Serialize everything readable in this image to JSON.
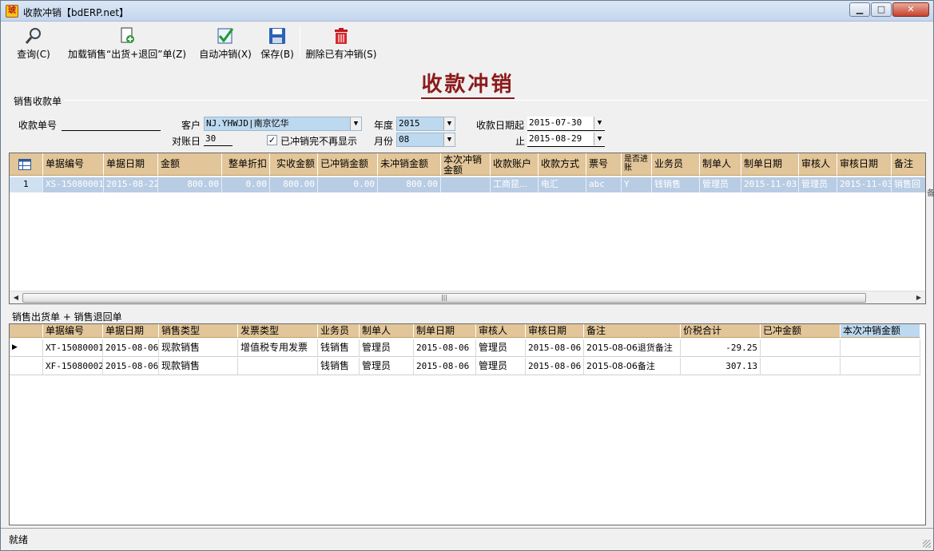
{
  "window": {
    "title": "收款冲销【bdERP.net】",
    "min": "▁",
    "max": "□",
    "close": "✕"
  },
  "toolbar": {
    "query": "查询(C)",
    "load": "加载销售“出货+退回”单(Z)",
    "auto": "自动冲销(X)",
    "save": "保存(B)",
    "delete": "删除已有冲销(S)"
  },
  "heading": "收款冲销",
  "receipt_section": {
    "title": "销售收款单",
    "receipt_no_label": "收款单号",
    "receipt_no_value": "",
    "customer_label": "客户",
    "customer_value": "NJ.YHWJD|南京忆华",
    "recon_day_label": "对账日",
    "recon_day_value": "30",
    "hide_done_label": "已冲销完不再显示",
    "hide_done_checked": "✓",
    "year_label": "年度",
    "year_value": "2015",
    "month_label": "月份",
    "month_value": "08",
    "date_from_label": "收款日期起",
    "date_from_value": "2015-07-30",
    "date_to_label": "止",
    "date_to_value": "2015-08-29"
  },
  "grid1": {
    "columns": [
      "单据编号",
      "单据日期",
      "金额",
      "整单折扣",
      "实收金额",
      "已冲销金额",
      "未冲销金额",
      "本次冲销金额",
      "收款账户",
      "收款方式",
      "票号",
      "是否进账",
      "业务员",
      "制单人",
      "制单日期",
      "审核人",
      "审核日期",
      "备注"
    ],
    "rows": [
      [
        "1",
        "XS-15080001",
        "2015-08-22",
        "800.00",
        "0.00",
        "800.00",
        "0.00",
        "800.00",
        "",
        "工商昆...",
        "电汇",
        "abc",
        "Y",
        "钱销售",
        "管理员",
        "2015-11-03",
        "管理员",
        "2015-11-03",
        "销售回"
      ]
    ],
    "overflow_hint": "备"
  },
  "detail_section": {
    "title": "销售出货单 + 销售退回单"
  },
  "grid2": {
    "columns": [
      "单据编号",
      "单据日期",
      "销售类型",
      "发票类型",
      "业务员",
      "制单人",
      "制单日期",
      "审核人",
      "审核日期",
      "备注",
      "价税合计",
      "已冲金额",
      "本次冲销金额"
    ],
    "rows": [
      [
        "▶",
        "XT-15080001",
        "2015-08-06",
        "现款销售",
        "增值税专用发票",
        "钱销售",
        "管理员",
        "2015-08-06",
        "管理员",
        "2015-08-06",
        "2015-08-06退货备注",
        "-29.25",
        "",
        ""
      ],
      [
        "",
        "XF-15080002",
        "2015-08-06",
        "现款销售",
        "",
        "钱销售",
        "管理员",
        "2015-08-06",
        "管理员",
        "2015-08-06",
        "2015-08-06备注",
        "307.13",
        "",
        ""
      ]
    ]
  },
  "status": "就绪",
  "colors": {
    "header_bg": "#e2c598",
    "selected_row": "#b8cce4",
    "heading": "#8b1a1a"
  }
}
